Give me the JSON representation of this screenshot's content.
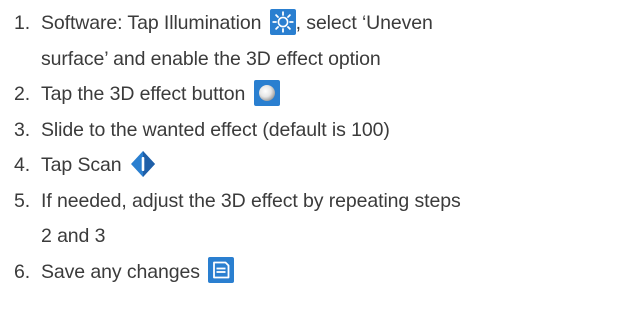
{
  "steps": [
    {
      "number": "1.",
      "text_before_icon": "Software: Tap Illumination",
      "icon": "illumination-sun-icon",
      "text_after_icon": ", select ‘Uneven",
      "continuation": "surface’ and enable the 3D effect option"
    },
    {
      "number": "2.",
      "text_before_icon": "Tap the 3D effect button",
      "icon": "3d-effect-sphere-icon"
    },
    {
      "number": "3.",
      "text": "Slide to the wanted effect (default is 100)"
    },
    {
      "number": "4.",
      "text_before_icon": "Tap Scan",
      "icon": "scan-diamond-icon"
    },
    {
      "number": "5.",
      "text": "If needed, adjust the 3D effect by repeating steps",
      "continuation": "2 and 3"
    },
    {
      "number": "6.",
      "text_before_icon": "Save any changes",
      "icon": "save-icon"
    }
  ],
  "colors": {
    "text": "#3b3b3b",
    "icon_blue": "#2a7fd0",
    "icon_blue_dark": "#1f5fa8"
  }
}
